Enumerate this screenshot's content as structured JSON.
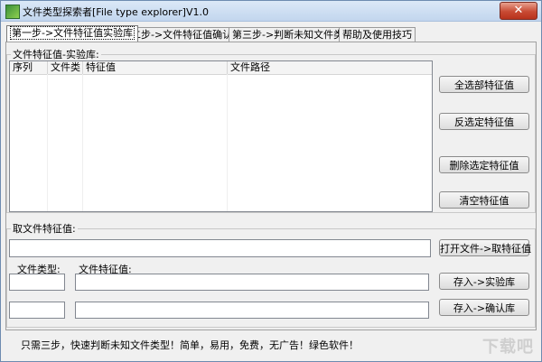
{
  "window": {
    "title": "文件类型探索者[File type explorer]V1.0",
    "close_symbol": "✕"
  },
  "tabs": [
    {
      "label": "第一步->文件特征值实验库",
      "active": true
    },
    {
      "label": "第二步->文件特征值确认库",
      "active": false
    },
    {
      "label": "第三步->判断未知文件类型",
      "active": false
    },
    {
      "label": "帮助及使用技巧",
      "active": false
    }
  ],
  "experiment_group": {
    "legend": "文件特征值-实验库:",
    "columns": [
      "序列",
      "文件类",
      "特征值",
      "文件路径"
    ],
    "rows": []
  },
  "side_buttons": {
    "select_all": "全选部特征值",
    "invert_select": "反选定特征值",
    "delete_selected": "删除选定特征值",
    "clear": "清空特征值"
  },
  "extract_group": {
    "legend": "取文件特征值:",
    "path_value": "",
    "open_button": "打开文件->取特征值",
    "file_type_label": "文件类型:",
    "feature_label": "文件特征值:",
    "file_type_value": "",
    "feature_value": "",
    "save_experiment_button": "存入->实验库",
    "file_type_value_2": "",
    "feature_value_2": "",
    "save_confirm_button": "存入->确认库"
  },
  "status_text": "只需三步，快速判断未知文件类型！简单，易用，免费，无广告！绿色软件！",
  "watermark": "下载吧"
}
